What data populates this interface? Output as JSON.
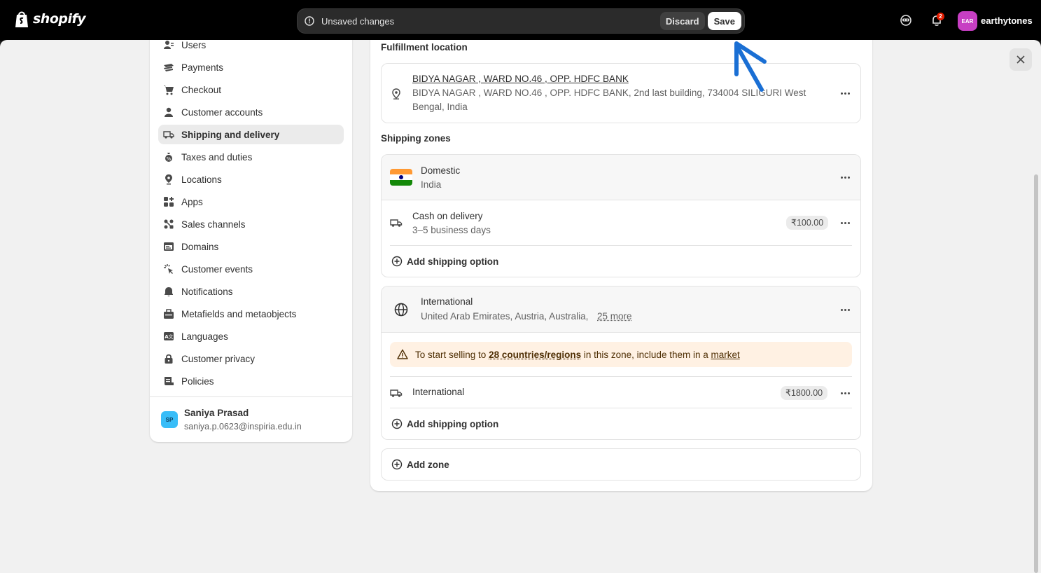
{
  "topbar": {
    "logo_text": "shopify",
    "unsaved_text": "Unsaved changes",
    "discard_label": "Discard",
    "save_label": "Save",
    "notification_count": "2",
    "store_initials": "EAR",
    "store_name": "earthytones"
  },
  "sidebar": {
    "items": [
      {
        "label": "Users",
        "icon": "users-icon"
      },
      {
        "label": "Payments",
        "icon": "payments-icon"
      },
      {
        "label": "Checkout",
        "icon": "cart-icon"
      },
      {
        "label": "Customer accounts",
        "icon": "person-icon"
      },
      {
        "label": "Shipping and delivery",
        "icon": "truck-icon",
        "active": true
      },
      {
        "label": "Taxes and duties",
        "icon": "tax-icon"
      },
      {
        "label": "Locations",
        "icon": "location-icon"
      },
      {
        "label": "Apps",
        "icon": "apps-icon"
      },
      {
        "label": "Sales channels",
        "icon": "sales-channels-icon"
      },
      {
        "label": "Domains",
        "icon": "domains-icon"
      },
      {
        "label": "Customer events",
        "icon": "cursor-icon"
      },
      {
        "label": "Notifications",
        "icon": "bell-icon"
      },
      {
        "label": "Metafields and metaobjects",
        "icon": "metafields-icon"
      },
      {
        "label": "Languages",
        "icon": "language-icon"
      },
      {
        "label": "Customer privacy",
        "icon": "lock-icon"
      },
      {
        "label": "Policies",
        "icon": "policies-icon"
      }
    ],
    "user": {
      "initials": "SP",
      "name": "Saniya Prasad",
      "email": "saniya.p.0623@inspiria.edu.in"
    }
  },
  "content": {
    "fulfillment_title": "Fulfillment location",
    "location_name": "BIDYA NAGAR , WARD NO.46 , OPP. HDFC BANK",
    "location_address_line1": "BIDYA NAGAR , WARD NO.46 , OPP. HDFC BANK, 2nd last building, 734004 SILIGURI West",
    "location_address_line2": "Bengal, India",
    "zones_title": "Shipping zones",
    "domestic": {
      "name": "Domestic",
      "countries": "India",
      "rate_name": "Cash on delivery",
      "rate_time": "3–5 business days",
      "rate_price": "₹100.00",
      "add_option": "Add shipping option"
    },
    "international": {
      "name": "International",
      "countries": "United Arab Emirates, Austria, Australia,",
      "more": "25 more",
      "banner_pre": "To start selling to",
      "banner_bold": "28 countries/regions",
      "banner_mid": "in this zone, include them in a",
      "banner_link": "market",
      "rate_name": "International",
      "rate_price": "₹1800.00",
      "add_option": "Add shipping option"
    },
    "add_zone": "Add zone"
  },
  "colors": {
    "annotation_arrow": "#1a6fd4",
    "store_avatar": "#c73fc3",
    "user_avatar": "#38bdf8",
    "banner_bg": "#fff1e3"
  }
}
